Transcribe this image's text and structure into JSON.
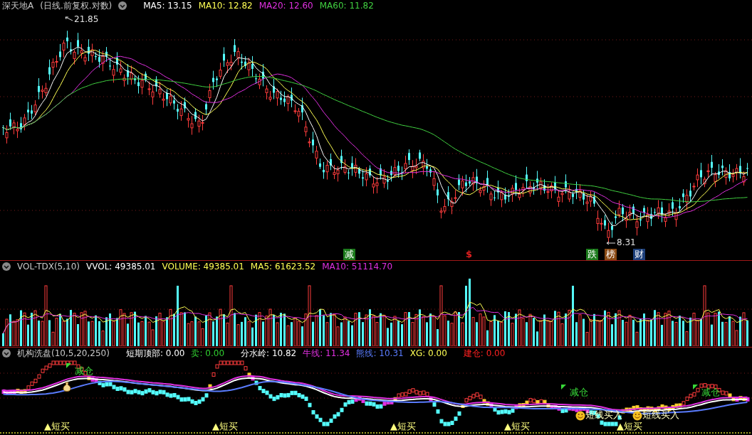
{
  "main_panel": {
    "title": "深天地A",
    "period": "(日线.前复权.对数)",
    "indicators": [
      {
        "label": "MA5: 13.15",
        "color": "#ffffff"
      },
      {
        "label": "MA10: 12.82",
        "color": "#ffff54"
      },
      {
        "label": "MA20: 12.60",
        "color": "#e030e0"
      },
      {
        "label": "MA60: 11.82",
        "color": "#40d040"
      }
    ],
    "high_label": "21.85",
    "low_label": "8.31",
    "markers": [
      {
        "text": "减",
        "color": "#1c7a1c"
      },
      {
        "text": "$",
        "color": "#e02020"
      },
      {
        "text": "跌",
        "color": "#1c7a1c"
      },
      {
        "text": "榜",
        "color": "#8a4a14"
      },
      {
        "text": "财",
        "color": "#1c3f7a"
      }
    ]
  },
  "volume_panel": {
    "title": "VOL-TDX(5,10)",
    "indicators": [
      {
        "label": "VVOL: 49385.01",
        "color": "#ffffff"
      },
      {
        "label": "VOLUME: 49385.01",
        "color": "#ffff54"
      },
      {
        "label": "MA5: 61623.52",
        "color": "#ffff54"
      },
      {
        "label": "MA10: 51114.70",
        "color": "#e030e0"
      }
    ]
  },
  "indicator_panel": {
    "title": "机构洗盘(10,5,20,250)",
    "indicators": [
      {
        "label": "短期顶部: 0.00",
        "color": "#ffffff"
      },
      {
        "label": "卖: 0.00",
        "color": "#30d030"
      },
      {
        "label": "分水岭: 10.82",
        "color": "#ffffff"
      },
      {
        "label": "牛线: 11.34",
        "color": "#e030e0"
      },
      {
        "label": "熊线: 10.31",
        "color": "#5a7cff"
      },
      {
        "label": "XG: 0.00",
        "color": "#ffff54"
      },
      {
        "label": "建仓: 0.00",
        "color": "#ff2020"
      }
    ],
    "signals": [
      {
        "kind": "buy",
        "text": "▲短买"
      },
      {
        "kind": "money_bag"
      },
      {
        "kind": "flag",
        "text": "减仓"
      },
      {
        "kind": "buy",
        "text": "▲短买"
      },
      {
        "kind": "buy",
        "text": "▲短买"
      },
      {
        "kind": "buy",
        "text": "▲短买"
      },
      {
        "kind": "flag",
        "text": "减仓"
      },
      {
        "kind": "smiley",
        "text": "短线买入"
      },
      {
        "kind": "buy",
        "text": "▲短买"
      },
      {
        "kind": "smiley",
        "text": "短线买入"
      },
      {
        "kind": "flag",
        "text": "减仓"
      }
    ]
  }
}
